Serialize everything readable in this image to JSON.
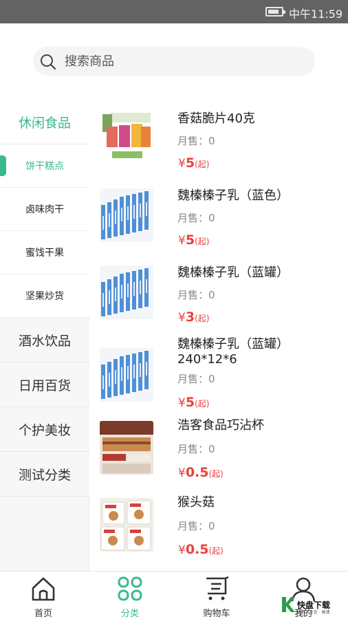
{
  "status_bar": {
    "time": "中午11:59",
    "battery_level": 0.85
  },
  "search": {
    "placeholder": "搜索商品"
  },
  "categories": [
    {
      "label": "休闲食品",
      "active": true
    },
    {
      "label": "酒水饮品",
      "active": false
    },
    {
      "label": "日用百货",
      "active": false
    },
    {
      "label": "个护美妆",
      "active": false
    },
    {
      "label": "测试分类",
      "active": false
    }
  ],
  "subcategories": [
    {
      "label": "饼干糕点",
      "active": true
    },
    {
      "label": "卤味肉干",
      "active": false
    },
    {
      "label": "蜜饯干果",
      "active": false
    },
    {
      "label": "坚果炒货",
      "active": false
    }
  ],
  "products": [
    {
      "name": "香菇脆片40克",
      "sales": "月售：0",
      "currency": "¥",
      "price": "5",
      "price_unit": "(起)",
      "image": "mushroom-chips-box"
    },
    {
      "name": "魏榛榛子乳（蓝色）",
      "sales": "月售：0",
      "currency": "¥",
      "price": "5",
      "price_unit": "(起)",
      "image": "hazelnut-milk-cans"
    },
    {
      "name": "魏榛榛子乳（蓝罐）",
      "sales": "月售：0",
      "currency": "¥",
      "price": "3",
      "price_unit": "(起)",
      "image": "hazelnut-milk-cans"
    },
    {
      "name": "魏榛榛子乳（蓝罐）",
      "name_line2": "240*12*6",
      "sales": "月售：0",
      "currency": "¥",
      "price": "5",
      "price_unit": "(起)",
      "image": "hazelnut-milk-cans"
    },
    {
      "name": "浩客食品巧沾杯",
      "sales": "月售：0",
      "currency": "¥",
      "price": "0.5",
      "price_unit": "(起)",
      "image": "choco-dip-cups"
    },
    {
      "name": "猴头菇",
      "sales": "月售：0",
      "currency": "¥",
      "price": "0.5",
      "price_unit": "(起)",
      "image": "monkey-head-biscuits"
    }
  ],
  "bottom_nav": [
    {
      "label": "首页",
      "icon": "home-icon",
      "active": false
    },
    {
      "label": "分类",
      "icon": "category-grid-icon",
      "active": true
    },
    {
      "label": "购物车",
      "icon": "cart-icon",
      "active": false
    },
    {
      "label": "我的",
      "icon": "user-icon",
      "active": false
    }
  ],
  "watermark": {
    "text": "快盘下载",
    "sub": "绿色 · 安全 · 高速"
  },
  "colors": {
    "accent": "#3bb98d",
    "price": "#e8413c",
    "status_bar": "#636363"
  }
}
